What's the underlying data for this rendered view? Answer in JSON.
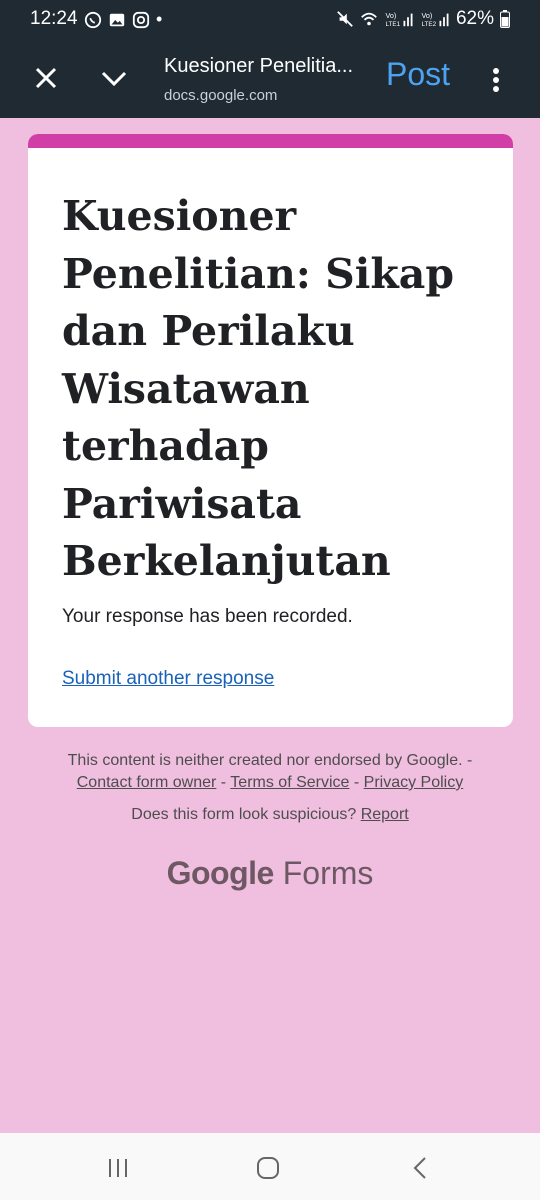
{
  "status_bar": {
    "time": "12:24",
    "dot": "•",
    "battery": "62%",
    "icons": [
      "whatsapp-icon",
      "gallery-icon",
      "instagram-icon",
      "mute-icon",
      "wifi-icon",
      "lte1-signal-icon",
      "lte2-signal-icon",
      "battery-icon"
    ]
  },
  "app_bar": {
    "title": "Kuesioner Penelitia...",
    "url": "docs.google.com",
    "post_label": "Post",
    "icons": [
      "close-icon",
      "chevron-down-icon",
      "more-vert-icon"
    ]
  },
  "form": {
    "title": "Kuesioner Penelitian: Sikap dan Perilaku Wisatawan terhadap Pariwisata Berkelanjutan",
    "response_message": "Your response has been recorded.",
    "submit_another": "Submit another response",
    "accent_color": "#d13ea5",
    "background_color": "#f0bfe0"
  },
  "footer": {
    "disclaimer": "This content is neither created nor endorsed by Google. -",
    "contact_owner": "Contact form owner",
    "separator": " - ",
    "terms": "Terms of Service",
    "privacy": "Privacy Policy",
    "suspicious_question": "Does this form look suspicious?",
    "report": "Report",
    "logo_brand": "Google",
    "logo_product": "Forms"
  },
  "nav_bar": {
    "icons": [
      "recents-icon",
      "home-icon",
      "back-icon"
    ]
  }
}
